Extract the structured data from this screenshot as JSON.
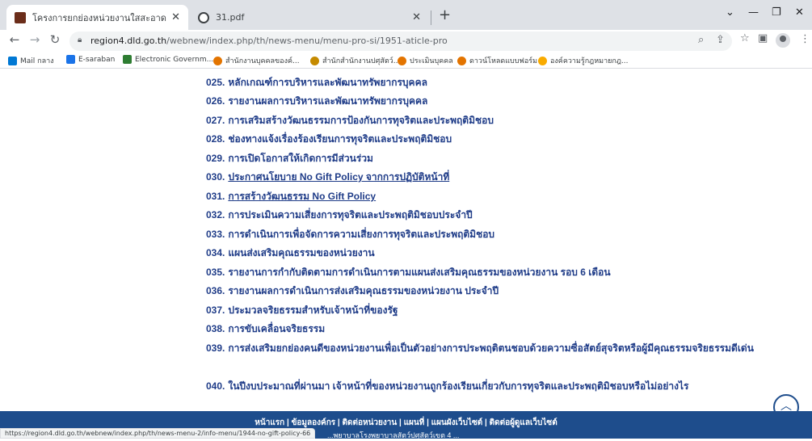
{
  "browser": {
    "tabs": [
      {
        "title": "โครงการยกย่องหน่วยงานใสสะอาดกระ...",
        "active": true,
        "favicon_color": "#6b2d1a"
      },
      {
        "title": "31.pdf",
        "active": false,
        "favicon_color": "#3c4043"
      }
    ],
    "new_tab": "+",
    "window_controls": {
      "minimize": "—",
      "restore": "❐",
      "close": "✕",
      "dropdown": "⌄"
    },
    "nav": {
      "back": "←",
      "forward": "→",
      "reload": "↻"
    },
    "address": {
      "host": "region4.dld.go.th",
      "path": "/webnew/index.php/th/news-menu/menu-pro-si/1951-aticle-pro"
    },
    "toolbar_icons": {
      "zoom": "⌕",
      "share": "⇪",
      "bookmark_star": "☆",
      "sidepanel": "▣",
      "menu": "⋮"
    }
  },
  "bookmarks": [
    {
      "label": "Mail กลาง",
      "color": "#0078d4"
    },
    {
      "label": "E-saraban",
      "color": "#1a73e8"
    },
    {
      "label": "Electronic Governm...",
      "color": "#2e7d32"
    },
    {
      "label": "สำนักงานบุคคลของค์...",
      "color": "#e37400"
    },
    {
      "label": "สำนักสำนักงานปศุสัตว์...",
      "color": "#c58a00"
    },
    {
      "label": "ประเมินบุคคล",
      "color": "#e37400"
    },
    {
      "label": "ดาวน์โหลดแบบฟอร์ม",
      "color": "#e37400"
    },
    {
      "label": "องค์ความรู้กฎหมายกฎ...",
      "color": "#f9ab00"
    }
  ],
  "items": [
    {
      "num": "025.",
      "text": "หลักเกณฑ์การบริหารและพัฒนาทรัพยากรบุคคล",
      "link": false
    },
    {
      "num": "026.",
      "text": "รายงานผลการบริหารและพัฒนาทรัพยากรบุคคล",
      "link": false
    },
    {
      "num": "027.",
      "text": "การเสริมสร้างวัฒนธรรมการป้องกันการทุจริตและประพฤติมิชอบ",
      "link": false
    },
    {
      "num": "028.",
      "text": "ช่องทางแจ้งเรื่องร้องเรียนการทุจริตและประพฤติมิชอบ",
      "link": false
    },
    {
      "num": "029.",
      "text": "การเปิดโอกาสให้เกิดการมีส่วนร่วม",
      "link": false
    },
    {
      "num": "030.",
      "text": "ประกาศนโยบาย No Gift Policy จากการปฏิบัติหน้าที่",
      "link": true
    },
    {
      "num": "031.",
      "text": "การสร้างวัฒนธรรม No Gift Policy",
      "link": true
    },
    {
      "num": "032.",
      "text": "การประเมินความเสี่ยงการทุจริตและประพฤติมิชอบประจำปี",
      "link": false
    },
    {
      "num": "033.",
      "text": "การดำเนินการเพื่อจัดการความเสี่ยงการทุจริตและประพฤติมิชอบ",
      "link": false
    },
    {
      "num": "034.",
      "text": "แผนส่งเสริมคุณธรรมของหน่วยงาน",
      "link": false
    },
    {
      "num": "035.",
      "text": "รายงานการกำกับติดตามการดำเนินการตามแผนส่งเสริมคุณธรรมของหน่วยงาน รอบ 6 เดือน",
      "link": false
    },
    {
      "num": "036.",
      "text": "รายงานผลการดำเนินการส่งเสริมคุณธรรมของหน่วยงาน ประจำปี",
      "link": false
    },
    {
      "num": "037.",
      "text": "ประมวลจริยธรรมสำหรับเจ้าหน้าที่ของรัฐ",
      "link": false
    },
    {
      "num": "038.",
      "text": "การขับเคลื่อนจริยธรรม",
      "link": false
    },
    {
      "num": "039.",
      "text": "การส่งเสริมยกย่องคนดีของหน่วยงานเพื่อเป็นตัวอย่างการประพฤติตนชอบด้วยความซื่อสัตย์สุจริตหรือผู้มีคุณธรรมจริยธรรมดีเด่น",
      "link": false
    },
    {
      "num": "040.",
      "text": "ในปีงบประมาณที่ผ่านมา เจ้าหน้าที่ของหน่วยงานถูกร้องเรียนเกี่ยวกับการทุจริตและประพฤติมิชอบหรือไม่อย่างไร",
      "link": false
    }
  ],
  "footer": {
    "nav": "หน้าแรก | ข้อมูลองค์กร | ติดต่อหน่วยงาน | แผนที่ | แผนผังเว็บไซต์ | ติดต่อผู้ดูแลเว็บไซต์",
    "line2": "...พยาบาลโรงพยาบาลสัตว์ปศุสัตว์เขต 4 ...",
    "scroll_top": "︿"
  },
  "status_url": "https://region4.dld.go.th/webnew/index.php/th/news-menu-2/info-menu/1944-no-gift-policy-66"
}
